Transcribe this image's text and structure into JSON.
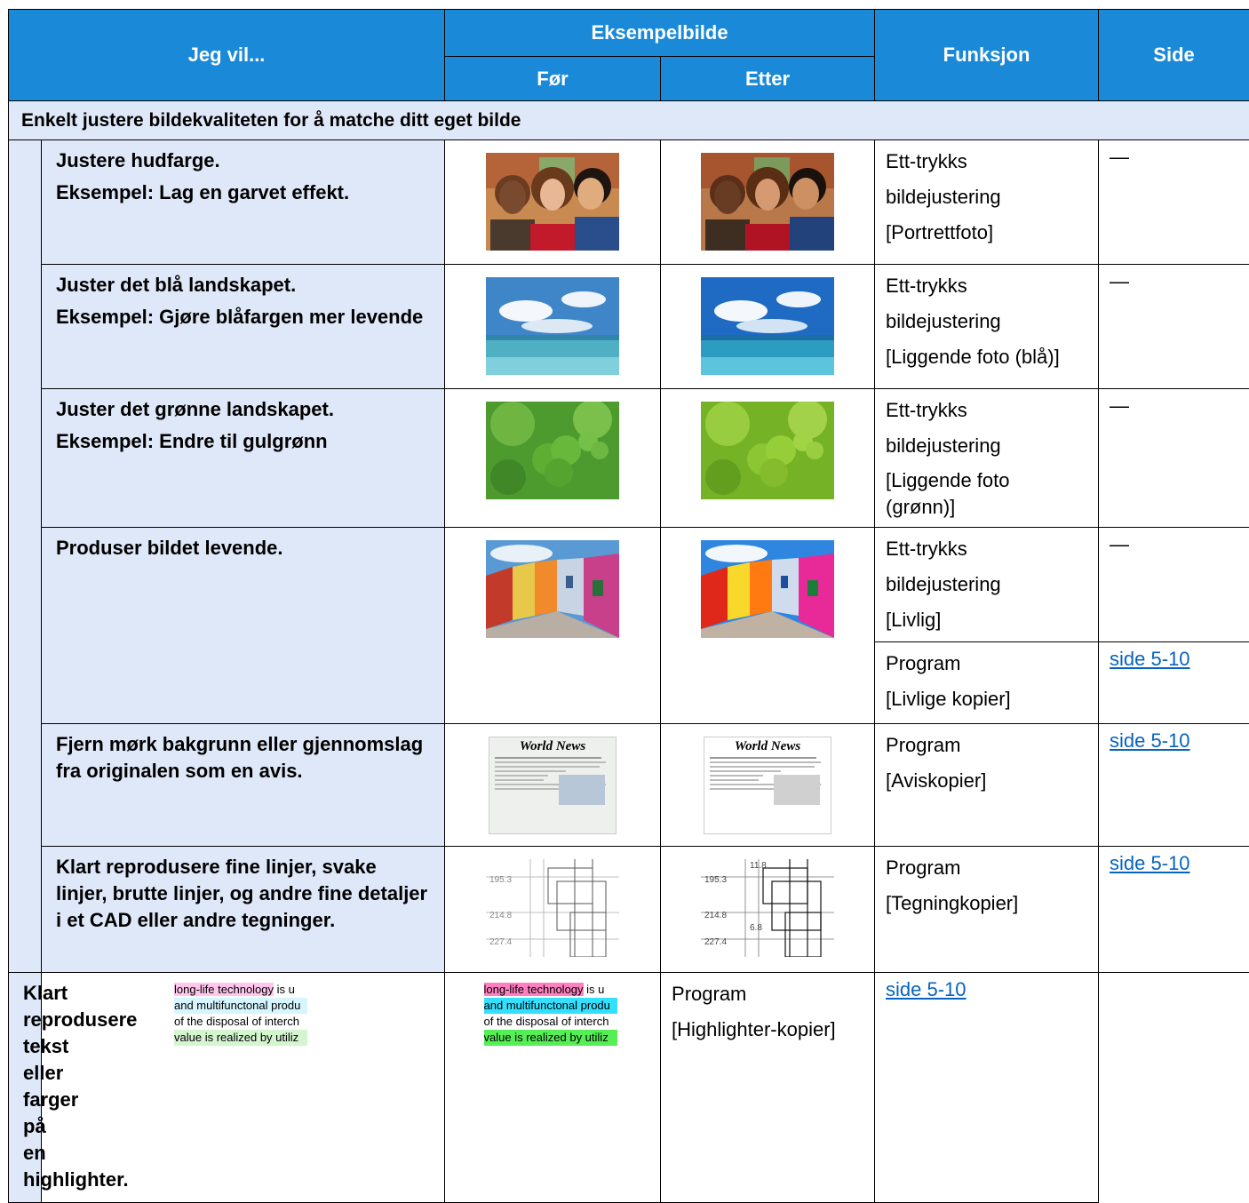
{
  "header": {
    "want": "Jeg vil...",
    "example": "Eksempelbilde",
    "before": "Før",
    "after": "Etter",
    "function": "Funksjon",
    "page": "Side"
  },
  "section_title": "Enkelt justere bildekvaliteten for å matche ditt eget bilde",
  "rows": [
    {
      "want": [
        "Justere hudfarge.",
        "Eksempel: Lag en garvet effekt."
      ],
      "functions": [
        {
          "lines": [
            "Ett-trykks",
            "bildejustering",
            "[Portrettfoto]"
          ],
          "page": "—"
        }
      ]
    },
    {
      "want": [
        "Juster det blå landskapet.",
        "Eksempel: Gjøre blåfargen mer levende"
      ],
      "functions": [
        {
          "lines": [
            "Ett-trykks",
            "bildejustering",
            "[Liggende foto (blå)]"
          ],
          "page": "—"
        }
      ]
    },
    {
      "want": [
        "Juster det grønne landskapet.",
        "Eksempel: Endre til gulgrønn"
      ],
      "functions": [
        {
          "lines": [
            "Ett-trykks",
            "bildejustering",
            "[Liggende foto",
            "(grønn)]"
          ],
          "page": "—"
        }
      ]
    },
    {
      "want": [
        "Produser bildet levende."
      ],
      "functions": [
        {
          "lines": [
            "Ett-trykks",
            "bildejustering",
            "[Livlig]"
          ],
          "page": "—"
        },
        {
          "lines": [
            "Program",
            "[Livlige kopier]"
          ],
          "page": "side 5-10"
        }
      ]
    },
    {
      "want": [
        "Fjern mørk bakgrunn eller gjennomslag fra originalen som en avis."
      ],
      "functions": [
        {
          "lines": [
            "Program",
            "[Aviskopier]"
          ],
          "page": "side 5-10"
        }
      ]
    },
    {
      "want": [
        "Klart reprodusere fine linjer, svake linjer, brutte linjer, og andre fine detaljer i et CAD eller andre tegninger."
      ],
      "functions": [
        {
          "lines": [
            "Program",
            "[Tegningkopier]"
          ],
          "page": "side 5-10"
        }
      ]
    },
    {
      "want": [
        "Klart reprodusere tekst eller farger på en highlighter."
      ],
      "functions": [
        {
          "lines": [
            "Program",
            "[Highlighter-kopier]"
          ],
          "page": "side 5-10"
        }
      ]
    }
  ],
  "newspaper": {
    "title": "World News"
  },
  "cad": {
    "labels": [
      "195.3",
      "214.8",
      "227.4",
      "11.8",
      "6.8"
    ]
  },
  "highlighter": {
    "lines": [
      "long-life technology is u",
      "and multifunctonal produ",
      "of the disposal of interch",
      "value is realized by utiliz"
    ],
    "before_colors": [
      "#ffc7ec",
      "#d6f5ff",
      "#ffffff",
      "#d4f5cf"
    ],
    "after_colors": [
      "#ff7fc0",
      "#33e0ff",
      "#ffffff",
      "#55ee55"
    ]
  },
  "colors": {
    "header_bg": "#1a8ad8",
    "section_bg": "#dfe8f8",
    "link": "#0563c1"
  }
}
